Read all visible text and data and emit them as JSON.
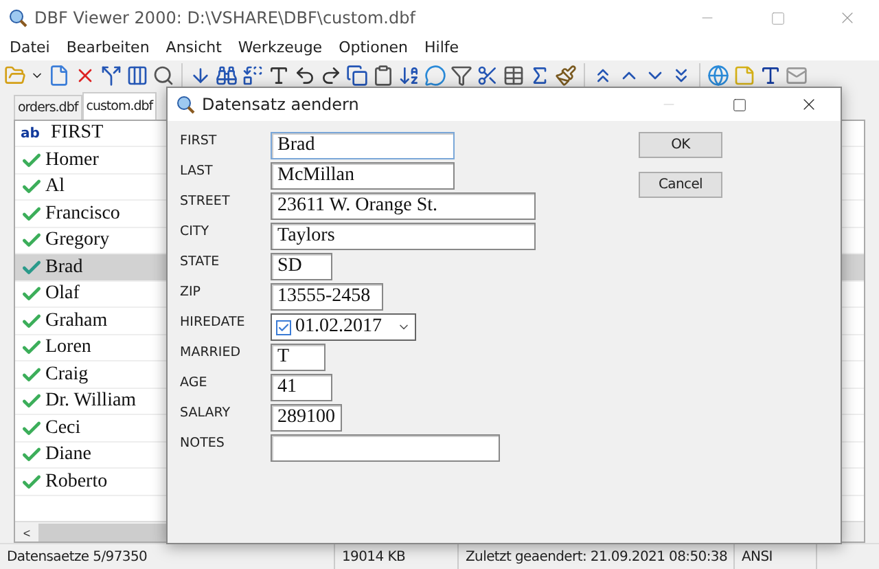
{
  "window": {
    "title": "DBF Viewer 2000: D:\\VSHARE\\DBF\\custom.dbf"
  },
  "menu": [
    "Datei",
    "Bearbeiten",
    "Ansicht",
    "Werkzeuge",
    "Optionen",
    "Hilfe"
  ],
  "tabs": [
    {
      "label": "orders.dbf",
      "selected": false
    },
    {
      "label": "custom.dbf",
      "selected": true
    }
  ],
  "grid": {
    "type_badge": "ab",
    "column": "FIRST",
    "rows": [
      {
        "value": "Homer",
        "selected": false
      },
      {
        "value": "Al",
        "selected": false
      },
      {
        "value": "Francisco",
        "selected": false
      },
      {
        "value": "Gregory",
        "selected": false
      },
      {
        "value": "Brad",
        "selected": true
      },
      {
        "value": "Olaf",
        "selected": false
      },
      {
        "value": "Graham",
        "selected": false
      },
      {
        "value": "Loren",
        "selected": false
      },
      {
        "value": "Craig",
        "selected": false
      },
      {
        "value": "Dr. William",
        "selected": false
      },
      {
        "value": "Ceci",
        "selected": false
      },
      {
        "value": "Diane",
        "selected": false
      },
      {
        "value": "Roberto",
        "selected": false
      }
    ],
    "scroll_left": "<"
  },
  "dialog": {
    "title": "Datensatz aendern",
    "fields": [
      {
        "label": "FIRST",
        "value": "Brad",
        "kind": "text"
      },
      {
        "label": "LAST",
        "value": "McMillan",
        "kind": "text"
      },
      {
        "label": "STREET",
        "value": "23611 W. Orange St.",
        "kind": "text"
      },
      {
        "label": "CITY",
        "value": "Taylors",
        "kind": "text"
      },
      {
        "label": "STATE",
        "value": "SD",
        "kind": "text"
      },
      {
        "label": "ZIP",
        "value": "13555-2458",
        "kind": "text"
      },
      {
        "label": "HIREDATE",
        "value": "01.02.2017",
        "kind": "date",
        "checked": true
      },
      {
        "label": "MARRIED",
        "value": "T",
        "kind": "text"
      },
      {
        "label": "AGE",
        "value": "41",
        "kind": "text"
      },
      {
        "label": "SALARY",
        "value": "289100",
        "kind": "text"
      },
      {
        "label": "NOTES",
        "kind": "text"
      }
    ],
    "buttons": [
      "OK",
      "Cancel"
    ]
  },
  "status_bar": [
    "Datensaetze 5/97350",
    "19014 KB",
    "Zuletzt geaendert: 21.09.2021 08:50:38",
    "ANSI"
  ]
}
